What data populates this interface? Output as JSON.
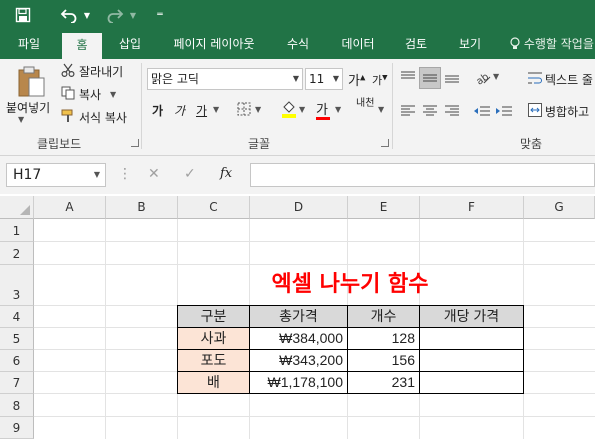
{
  "quick_access": {
    "save_icon": "save-icon",
    "undo_icon": "undo-icon",
    "redo_icon": "redo-icon",
    "customize_icon": "customize-icon"
  },
  "ribbon_tabs": [
    "파일",
    "홈",
    "삽입",
    "페이지 레이아웃",
    "수식",
    "데이터",
    "검토",
    "보기"
  ],
  "active_tab": "홈",
  "tell_me": "수행할 작업을",
  "clipboard": {
    "paste": "붙여넣기",
    "cut": "잘라내기",
    "copy": "복사",
    "format_painter": "서식 복사",
    "group": "클립보드"
  },
  "font": {
    "name": "맑은 고딕",
    "size": "11",
    "group": "글꼴",
    "grow": "가",
    "shrink": "가",
    "bold": "가",
    "italic": "가",
    "underline": "가",
    "font_color_glyph": "가",
    "phonetic": "내천"
  },
  "alignment": {
    "wrap_text": "텍스트 줄",
    "merge": "병합하고",
    "group": "맞춤"
  },
  "colors": {
    "excel_green": "#217346",
    "font_color_bar": "#ff0000",
    "fill_bar": "#ffff00",
    "title_red": "#ff0000"
  },
  "formula_bar": {
    "name_box": "H17",
    "fx": "fx",
    "cancel": "✕",
    "enter": "✓",
    "formula": ""
  },
  "columns": [
    "A",
    "B",
    "C",
    "D",
    "E",
    "F",
    "G"
  ],
  "rows": [
    "1",
    "2",
    "3",
    "4",
    "5",
    "6",
    "7",
    "8",
    "9"
  ],
  "sheet": {
    "title": "엑셀 나누기 함수",
    "headers": [
      "구분",
      "총가격",
      "개수",
      "개당 가격"
    ],
    "rows": [
      {
        "item": "사과",
        "total": "₩384,000",
        "count": "128",
        "unit": ""
      },
      {
        "item": "포도",
        "total": "₩343,200",
        "count": "156",
        "unit": ""
      },
      {
        "item": "배",
        "total": "₩1,178,100",
        "count": "231",
        "unit": ""
      }
    ]
  }
}
